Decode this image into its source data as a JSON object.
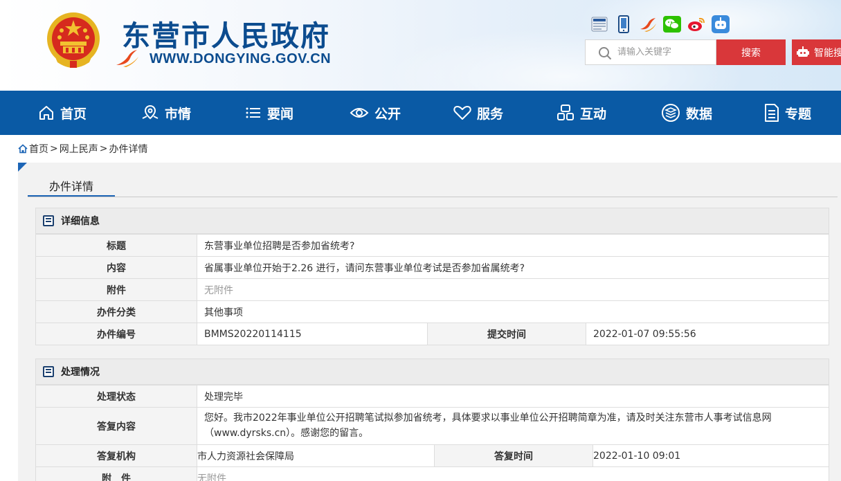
{
  "header": {
    "site_title": "东营市人民政府",
    "site_url": "WWW.DONGYING.GOV.CN",
    "social_icons": [
      "gov-mini-icon",
      "mobile-icon",
      "app-icon",
      "wechat-icon",
      "weibo-icon",
      "robot-icon"
    ],
    "search": {
      "placeholder": "请输入关键字",
      "button_label": "搜索"
    },
    "smart_label": "智能搜"
  },
  "nav": {
    "items": [
      {
        "label": "首页",
        "icon": "home-icon"
      },
      {
        "label": "市情",
        "icon": "map-icon"
      },
      {
        "label": "要闻",
        "icon": "list-icon"
      },
      {
        "label": "公开",
        "icon": "eye-icon"
      },
      {
        "label": "服务",
        "icon": "heart-icon"
      },
      {
        "label": "互动",
        "icon": "interact-icon"
      },
      {
        "label": "数据",
        "icon": "data-icon"
      },
      {
        "label": "专题",
        "icon": "doc-icon"
      }
    ]
  },
  "breadcrumb": {
    "home": "首页",
    "sep1": ">",
    "level1": "网上民声",
    "sep2": ">",
    "current": "办件详情"
  },
  "page": {
    "title": "办件详情"
  },
  "detail": {
    "heading": "详细信息",
    "rows": {
      "title": {
        "label": "标题",
        "value": "东营事业单位招聘是否参加省统考?"
      },
      "content": {
        "label": "内容",
        "value": "省属事业单位开始于2.26 进行，请问东营事业单位考试是否参加省属统考?"
      },
      "attachment": {
        "label": "附件",
        "value": "无附件"
      },
      "category": {
        "label": "办件分类",
        "value": "其他事项"
      },
      "number": {
        "label": "办件编号",
        "value": "BMMS20220114115",
        "time_label": "提交时间",
        "time_value": "2022-01-07 09:55:56"
      }
    }
  },
  "handling": {
    "heading": "处理情况",
    "rows": {
      "status": {
        "label": "处理状态",
        "value": "处理完毕"
      },
      "reply": {
        "label": "答复内容",
        "value": "您好。我市2022年事业单位公开招聘笔试拟参加省统考，具体要求以事业单位公开招聘简章为准，请及时关注东营市人事考试信息网（www.dyrsks.cn）。感谢您的留言。"
      },
      "org": {
        "label": "答复机构",
        "value": "市人力资源社会保障局",
        "time_label": "答复时间",
        "time_value": "2022-01-10 09:01"
      },
      "attachment": {
        "label": "附　件",
        "value": "无附件"
      }
    }
  },
  "colors": {
    "nav_bg": "#0a5aa5",
    "brand_blue": "#0c4c8f",
    "search_red": "#d9373a"
  }
}
